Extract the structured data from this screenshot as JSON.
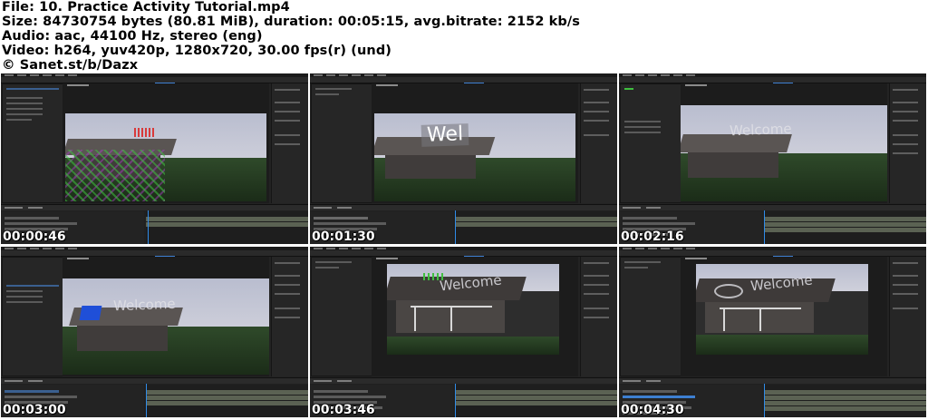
{
  "info": {
    "line1": "File: 10. Practice Activity Tutorial.mp4",
    "line2": "Size: 84730754 bytes (80.81 MiB), duration: 00:05:15, avg.bitrate: 2152 kb/s",
    "line3": "Audio: aac, 44100 Hz, stereo (eng)",
    "line4": "Video: h264, yuv420p, 1280x720, 30.00 fps(r) (und)",
    "line5": "© Sanet.st/b/Dazx"
  },
  "thumbnails": [
    {
      "timestamp": "00:00:46",
      "overlay_text": ""
    },
    {
      "timestamp": "00:01:30",
      "overlay_text": "Wel"
    },
    {
      "timestamp": "00:02:16",
      "overlay_text": "Welcome"
    },
    {
      "timestamp": "00:03:00",
      "overlay_text": "Welcome"
    },
    {
      "timestamp": "00:03:46",
      "overlay_text": "Welcome"
    },
    {
      "timestamp": "00:04:30",
      "overlay_text": "Welcome"
    }
  ],
  "colors": {
    "ui_background": "#232323",
    "timeline_current_time": "#2f8be8",
    "tracker_points_green": "#3fbf3f",
    "tracker_points_red": "#d83a3a",
    "solid_blue": "#1f4fd8"
  }
}
